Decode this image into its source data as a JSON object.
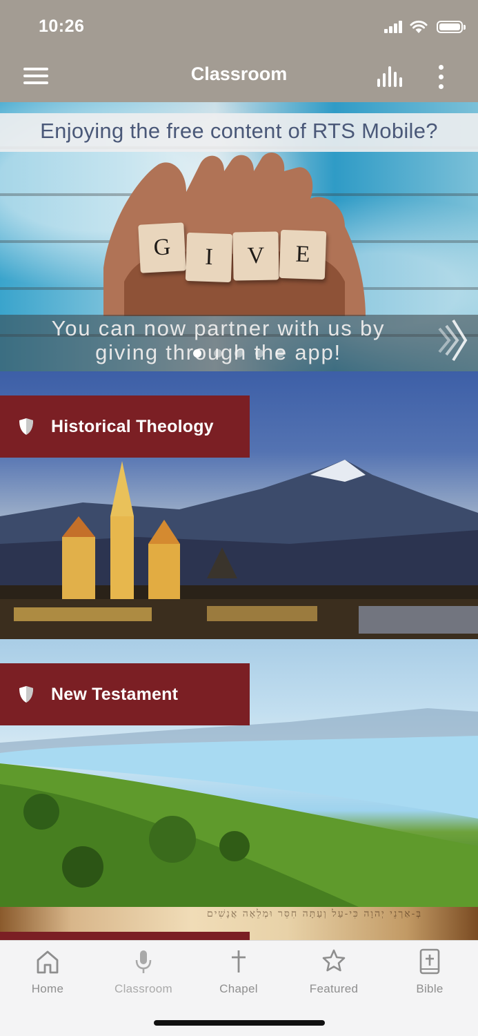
{
  "status_bar": {
    "time": "10:26"
  },
  "nav": {
    "title": "Classroom",
    "menu_icon": "hamburger-menu-icon",
    "audio_icon": "audio-bars-icon",
    "more_icon": "more-vertical-icon"
  },
  "banner": {
    "heading": "Enjoying the free content of RTS Mobile?",
    "tiles": [
      "G",
      "I",
      "V",
      "E"
    ],
    "subtitle_line1": "You can now partner with us by",
    "subtitle_line2": "giving through the app!",
    "slide_count": 5,
    "active_slide": 1
  },
  "categories": [
    {
      "label": "Historical Theology",
      "icon": "shield-icon"
    },
    {
      "label": "New Testament",
      "icon": "shield-icon"
    }
  ],
  "scroll_preview_text": "בְּ-אַרְנֵי יְהוָה כִּי-עַל וְעַתָּה חִסֵּר וּמְלֵאָה אֲנָשִׁים",
  "tabs": [
    {
      "label": "Home",
      "icon": "home-icon"
    },
    {
      "label": "Classroom",
      "icon": "microphone-icon"
    },
    {
      "label": "Chapel",
      "icon": "cross-icon"
    },
    {
      "label": "Featured",
      "icon": "star-icon"
    },
    {
      "label": "Bible",
      "icon": "bible-icon"
    }
  ],
  "colors": {
    "nav_bg": "#a39c93",
    "category_label_bg": "#7b1f24",
    "tab_inactive": "#8e8e8e"
  }
}
